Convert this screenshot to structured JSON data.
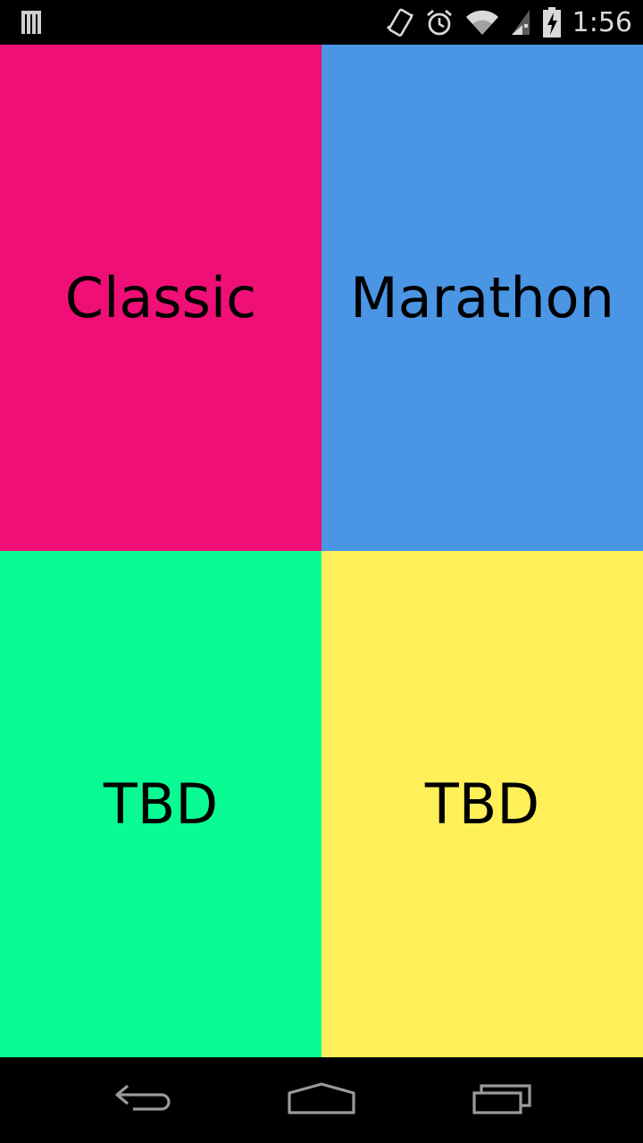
{
  "status_bar": {
    "time": "1:56",
    "icons": [
      "notification-bars-icon",
      "vibrate-icon",
      "alarm-icon",
      "wifi-icon",
      "signal-icon",
      "battery-charging-icon"
    ],
    "icon_color": "#d9d9d9"
  },
  "tiles": [
    {
      "label": "Classic",
      "color": "#ef0f77"
    },
    {
      "label": "Marathon",
      "color": "#4a95e4"
    },
    {
      "label": "TBD",
      "color": "#0bfb94"
    },
    {
      "label": "TBD",
      "color": "#fff05a"
    }
  ],
  "nav_bar": {
    "icons": [
      "back-icon",
      "home-icon",
      "recents-icon"
    ]
  }
}
